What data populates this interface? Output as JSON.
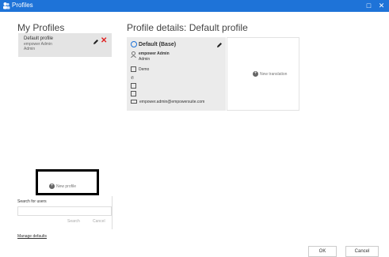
{
  "window": {
    "title": "Profiles",
    "minimize": "□",
    "close": "✕"
  },
  "left": {
    "heading": "My Profiles",
    "profile": {
      "name": "Default profile",
      "user": "empower Admin",
      "role": "Admin"
    },
    "new_profile_label": "New profile",
    "search": {
      "label": "Search for users",
      "value": "",
      "search_label": "Search",
      "cancel_label": "Cancel"
    },
    "manage_defaults": "Manage defaults"
  },
  "details": {
    "heading": "Profile details: Default profile",
    "base": {
      "title": "Default (Base)",
      "user_name": "empower Admin",
      "user_role": "Admin",
      "company": "Demo",
      "phone": "",
      "mobile": "",
      "fax": "",
      "email": "empower.admin@empowersuite.com"
    },
    "new_translation_label": "New translation"
  },
  "footer": {
    "ok_label": "OK",
    "cancel_label": "Cancel"
  },
  "colors": {
    "titlebar": "#1e73d8",
    "delete": "#e02020",
    "highlight": "#000000"
  }
}
